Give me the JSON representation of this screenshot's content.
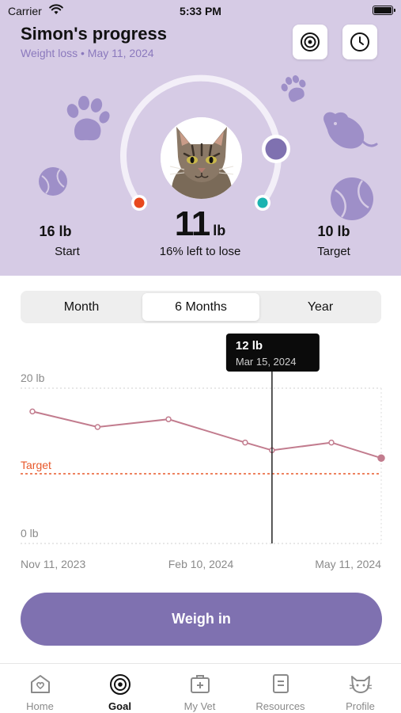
{
  "status_bar": {
    "carrier": "Carrier",
    "time": "5:33 PM"
  },
  "header": {
    "title": "Simon's progress",
    "subtitle": "Weight loss • May 11, 2024",
    "goal_icon": "target-icon",
    "history_icon": "clock-icon"
  },
  "progress": {
    "current_value": "11",
    "current_unit": "lb",
    "caption": "16% left to lose",
    "start_value": "16 lb",
    "start_label": "Start",
    "target_value": "10 lb",
    "target_label": "Target",
    "percent_left": 16
  },
  "range_tabs": [
    {
      "label": "Month",
      "active": false
    },
    {
      "label": "6 Months",
      "active": true
    },
    {
      "label": "Year",
      "active": false
    }
  ],
  "chart_data": {
    "type": "line",
    "y_ticks": [
      "20 lb",
      "0 lb"
    ],
    "ylim": [
      0,
      20
    ],
    "target_label": "Target",
    "target_value": 10,
    "x_ticks": [
      "Nov 11, 2023",
      "Feb 10, 2024",
      "May 11, 2024"
    ],
    "series": [
      {
        "values": [
          {
            "x": "2023-11-11",
            "y": 17
          },
          {
            "x": "2023-12-15",
            "y": 15
          },
          {
            "x": "2024-01-21",
            "y": 16
          },
          {
            "x": "2024-03-01",
            "y": 13
          },
          {
            "x": "2024-03-15",
            "y": 12
          },
          {
            "x": "2024-04-15",
            "y": 13
          },
          {
            "x": "2024-05-11",
            "y": 11
          }
        ]
      }
    ],
    "tooltip": {
      "value": "12 lb",
      "date": "Mar 15, 2024"
    },
    "colors": {
      "line": "#c27c8e",
      "target": "#e8582a",
      "tooltip_bg": "#0b0b0b"
    }
  },
  "weigh_in_label": "Weigh in",
  "tabs": [
    {
      "label": "Home",
      "icon": "home-heart-icon",
      "active": false
    },
    {
      "label": "Goal",
      "icon": "target-icon",
      "active": true
    },
    {
      "label": "My Vet",
      "icon": "vet-kit-icon",
      "active": false
    },
    {
      "label": "Resources",
      "icon": "document-icon",
      "active": false
    },
    {
      "label": "Profile",
      "icon": "cat-face-icon",
      "active": false
    }
  ],
  "colors": {
    "accent": "#7f71b0",
    "header_bg": "#d6cbe5",
    "subtitle": "#8b79bd"
  }
}
